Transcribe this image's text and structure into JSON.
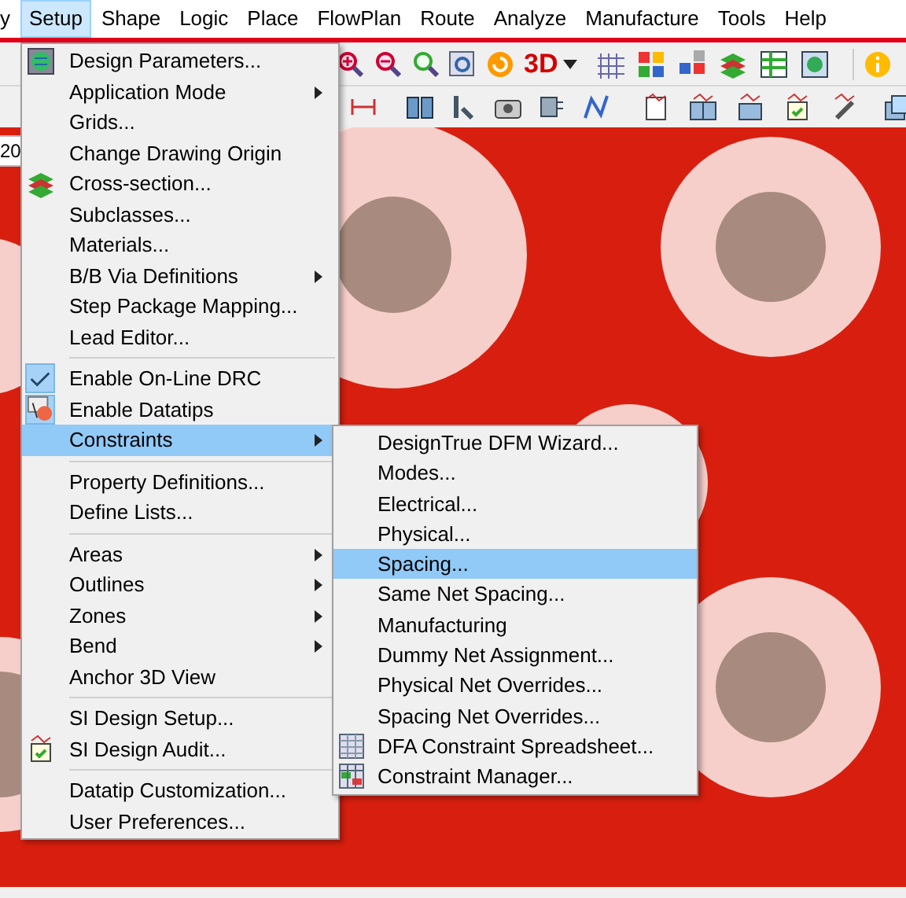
{
  "menubar": [
    {
      "label": "y",
      "selected": false
    },
    {
      "label": "Setup",
      "selected": true
    },
    {
      "label": "Shape",
      "selected": false
    },
    {
      "label": "Logic",
      "selected": false
    },
    {
      "label": "Place",
      "selected": false
    },
    {
      "label": "FlowPlan",
      "selected": false
    },
    {
      "label": "Route",
      "selected": false
    },
    {
      "label": "Analyze",
      "selected": false
    },
    {
      "label": "Manufacture",
      "selected": false
    },
    {
      "label": "Tools",
      "selected": false
    },
    {
      "label": "Help",
      "selected": false
    }
  ],
  "toolbar": {
    "three_d_label": "3D"
  },
  "left_field": {
    "value": "20"
  },
  "setup_menu": [
    {
      "kind": "item",
      "label": "Design Parameters...",
      "submenu": false,
      "checked": false,
      "selected": false
    },
    {
      "kind": "item",
      "label": "Application Mode",
      "submenu": true,
      "checked": false,
      "selected": false
    },
    {
      "kind": "item",
      "label": "Grids...",
      "submenu": false,
      "checked": false,
      "selected": false
    },
    {
      "kind": "item",
      "label": "Change Drawing Origin",
      "submenu": false,
      "checked": false,
      "selected": false
    },
    {
      "kind": "item",
      "label": "Cross-section...",
      "submenu": false,
      "checked": false,
      "selected": false
    },
    {
      "kind": "item",
      "label": "Subclasses...",
      "submenu": false,
      "checked": false,
      "selected": false
    },
    {
      "kind": "item",
      "label": "Materials...",
      "submenu": false,
      "checked": false,
      "selected": false
    },
    {
      "kind": "item",
      "label": "B/B Via Definitions",
      "submenu": true,
      "checked": false,
      "selected": false
    },
    {
      "kind": "item",
      "label": "Step Package Mapping...",
      "submenu": false,
      "checked": false,
      "selected": false
    },
    {
      "kind": "item",
      "label": "Lead Editor...",
      "submenu": false,
      "checked": false,
      "selected": false
    },
    {
      "kind": "separator"
    },
    {
      "kind": "item",
      "label": "Enable On-Line DRC",
      "submenu": false,
      "checked": true,
      "selected": false
    },
    {
      "kind": "item",
      "label": "Enable Datatips",
      "submenu": false,
      "checked": true,
      "selected": false
    },
    {
      "kind": "item",
      "label": "Constraints",
      "submenu": true,
      "checked": false,
      "selected": true
    },
    {
      "kind": "separator"
    },
    {
      "kind": "item",
      "label": "Property Definitions...",
      "submenu": false,
      "checked": false,
      "selected": false
    },
    {
      "kind": "item",
      "label": "Define Lists...",
      "submenu": false,
      "checked": false,
      "selected": false
    },
    {
      "kind": "separator"
    },
    {
      "kind": "item",
      "label": "Areas",
      "submenu": true,
      "checked": false,
      "selected": false
    },
    {
      "kind": "item",
      "label": "Outlines",
      "submenu": true,
      "checked": false,
      "selected": false
    },
    {
      "kind": "item",
      "label": "Zones",
      "submenu": true,
      "checked": false,
      "selected": false
    },
    {
      "kind": "item",
      "label": "Bend",
      "submenu": true,
      "checked": false,
      "selected": false
    },
    {
      "kind": "item",
      "label": "Anchor 3D View",
      "submenu": false,
      "checked": false,
      "selected": false
    },
    {
      "kind": "separator"
    },
    {
      "kind": "item",
      "label": "SI Design Setup...",
      "submenu": false,
      "checked": false,
      "selected": false
    },
    {
      "kind": "item",
      "label": "SI Design Audit...",
      "submenu": false,
      "checked": false,
      "selected": false
    },
    {
      "kind": "separator"
    },
    {
      "kind": "item",
      "label": "Datatip Customization...",
      "submenu": false,
      "checked": false,
      "selected": false
    },
    {
      "kind": "item",
      "label": "User Preferences...",
      "submenu": false,
      "checked": false,
      "selected": false
    }
  ],
  "constraints_menu": [
    {
      "label": "DesignTrue DFM Wizard...",
      "selected": false
    },
    {
      "label": "Modes...",
      "selected": false
    },
    {
      "label": "Electrical...",
      "selected": false
    },
    {
      "label": "Physical...",
      "selected": false
    },
    {
      "label": "Spacing...",
      "selected": true
    },
    {
      "label": "Same Net Spacing...",
      "selected": false
    },
    {
      "label": "Manufacturing",
      "selected": false
    },
    {
      "label": "Dummy Net Assignment...",
      "selected": false
    },
    {
      "label": "Physical Net Overrides...",
      "selected": false
    },
    {
      "label": "Spacing Net Overrides...",
      "selected": false
    },
    {
      "label": "DFA Constraint Spreadsheet...",
      "selected": false
    },
    {
      "label": "Constraint Manager...",
      "selected": false
    }
  ]
}
